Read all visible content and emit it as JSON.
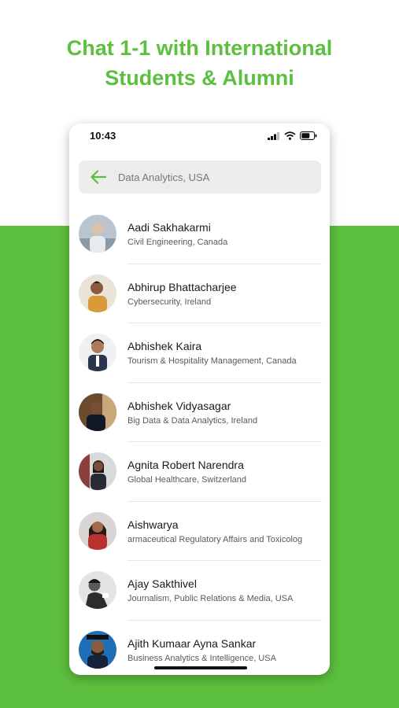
{
  "headline": {
    "line1": "Chat 1-1 with International",
    "line2": "Students & Alumni"
  },
  "status_bar": {
    "time": "10:43",
    "icons": [
      "signal-icon",
      "wifi-icon",
      "battery-icon"
    ]
  },
  "search": {
    "value": "Data Analytics, USA",
    "back_icon": "arrow-left-icon"
  },
  "colors": {
    "brand_green": "#5dbf3e",
    "search_bg": "#ececec"
  },
  "contacts": [
    {
      "name": "Aadi Sakhakarmi",
      "detail": "Civil Engineering, Canada"
    },
    {
      "name": "Abhirup Bhattacharjee",
      "detail": "Cybersecurity, Ireland"
    },
    {
      "name": "Abhishek Kaira",
      "detail": "Tourism & Hospitality Management, Canada"
    },
    {
      "name": "Abhishek Vidyasagar",
      "detail": "Big Data & Data Analytics, Ireland"
    },
    {
      "name": "Agnita Robert Narendra",
      "detail": "Global Healthcare, Switzerland"
    },
    {
      "name": "Aishwarya",
      "detail": "armaceutical Regulatory Affairs and Toxicolog"
    },
    {
      "name": "Ajay Sakthivel",
      "detail": "Journalism, Public Relations & Media, USA"
    },
    {
      "name": "Ajith Kumaar Ayna Sankar",
      "detail": "Business Analytics & Intelligence, USA"
    }
  ]
}
